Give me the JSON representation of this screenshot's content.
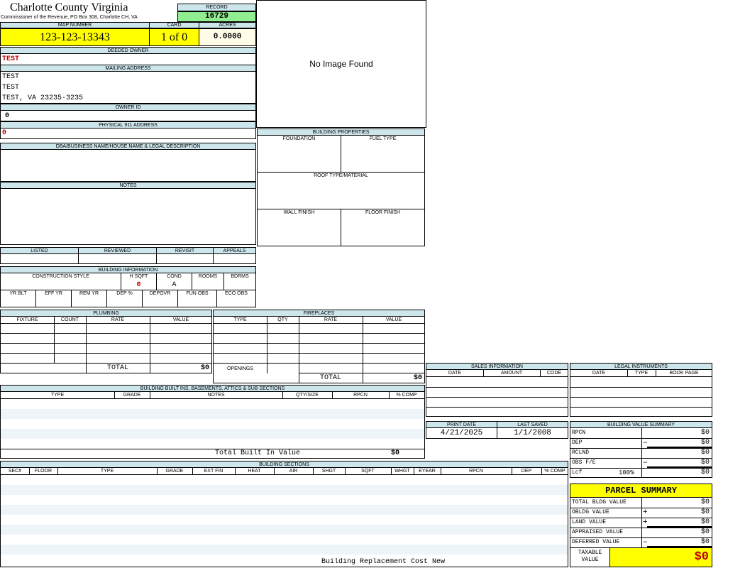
{
  "header": {
    "county": "Charlotte County Virginia",
    "commissioner": "Commissioner of the Revenue, PO Box 308, Charlotte CH, VA",
    "record_label": "RECORD",
    "record_value": "16729"
  },
  "parcel": {
    "map_number_label": "MAP NUMBER",
    "map_number": "123-123-13343",
    "card_label": "CARD",
    "card": "1 of 0",
    "acres_label": "ACRES",
    "acres": "0.0000"
  },
  "owner": {
    "deeded_owner_label": "DEEDED OWNER",
    "deeded_owner": "TEST",
    "mailing_address_label": "MAILING ADDRESS",
    "mailing_lines": [
      "TEST",
      "TEST",
      "TEST, VA 23235-3235"
    ],
    "owner_id_label": "OWNER ID",
    "owner_id": "0",
    "physical_address_label": "PHYSICAL 911 ADDRESS",
    "physical_address": "0"
  },
  "dba_label": "DBA/BUSINESS NAME/HOUSE NAME & LEGAL DESCRIPTION",
  "notes_label": "NOTES",
  "image_placeholder": "No Image Found",
  "building_properties": {
    "title": "BUILDING PROPERTIES",
    "foundation": "FOUNDATION",
    "fuel_type": "FUEL TYPE",
    "roof": "ROOF TYPE/MATERIAL",
    "wall": "WALL FINISH",
    "floor": "FLOOR FINISH"
  },
  "status_headers": [
    "LISTED",
    "REVIEWED",
    "REVISIT",
    "APPEALS"
  ],
  "building_info": {
    "title": "BUILDING INFORMATION",
    "row1": [
      "CONSTRUCTION STYLE",
      "H SQFT",
      "COND",
      "ROOMS",
      "BDRMS"
    ],
    "hsqft": "0",
    "cond": "A",
    "row2": [
      "YR BLT",
      "EFF YR",
      "REM YR",
      "DEP %",
      "DEPOVR",
      "FUN OBS",
      "ECO OBS"
    ]
  },
  "plumbing": {
    "title": "PLUMBING",
    "columns": [
      "FIXTURE",
      "COUNT",
      "RATE",
      "VALUE"
    ],
    "total_label": "TOTAL",
    "total": "$0"
  },
  "fireplaces": {
    "title": "FIREPLACES",
    "columns": [
      "TYPE",
      "QTY",
      "RATE",
      "VALUE"
    ],
    "openings_label": "OPENINGS",
    "total_label": "TOTAL",
    "total": "$0"
  },
  "built_ins": {
    "title": "BUILDING BUILT INS, BASEMENTS, ATTICS & SUB SECTIONS",
    "columns": [
      "TYPE",
      "GRADE",
      "NOTES",
      "QTY/SIZE",
      "RPCN",
      "% COMP"
    ],
    "total_label": "Total Built In Value",
    "total": "$0"
  },
  "sections": {
    "title": "BUILDING SECTIONS",
    "columns": [
      "SEC#",
      "FLOOR",
      "TYPE",
      "GRADE",
      "EXT FIN",
      "HEAT",
      "AIR",
      "SHGT",
      "SQFT",
      "WHGT",
      "EYEAR",
      "RPCN",
      "DEP",
      "% COMP"
    ],
    "footer": "Building Replacement Cost New"
  },
  "sales": {
    "title": "SALES INFORMATION",
    "columns": [
      "DATE",
      "AMOUNT",
      "CODE"
    ]
  },
  "legal": {
    "title": "LEGAL INSTRUMENTS",
    "columns": [
      "DATE",
      "TYPE",
      "BOOK PAGE"
    ]
  },
  "dates": {
    "print_label": "PRINT DATE",
    "print_date": "4/21/2025",
    "saved_label": "LAST SAVED",
    "last_saved": "1/1/2008"
  },
  "value_summary": {
    "title": "BUILDING VALUE SUMMARY",
    "rows": [
      {
        "label": "RPCN",
        "sign": "",
        "value": "$0"
      },
      {
        "label": "DEP",
        "sign": "–",
        "value": "$0"
      },
      {
        "label": "RCLND",
        "sign": "",
        "value": "$0"
      },
      {
        "label": "OBS F/E",
        "sign": "–",
        "value": "$0"
      },
      {
        "label": "Lcf",
        "sign": "",
        "value": "$0",
        "pct": "100%"
      }
    ]
  },
  "parcel_summary": {
    "title": "PARCEL SUMMARY",
    "rows": [
      {
        "label": "TOTAL BLDG VALUE",
        "sign": "",
        "value": "$0"
      },
      {
        "label": "OBLDG VALUE",
        "sign": "+",
        "value": "$0"
      },
      {
        "label": "LAND VALUE",
        "sign": "+",
        "value": "$0"
      },
      {
        "label": "APPRAISED VALUE",
        "sign": "",
        "value": "$0"
      },
      {
        "label": "DEFERRED VALUE",
        "sign": "–",
        "value": "$0"
      }
    ],
    "taxable_label": "TAXABLE VALUE",
    "taxable_value": "$0"
  },
  "colors": {
    "header_bg": "#cde6ec",
    "yellow": "#ffff00",
    "record_green": "#90ee90",
    "acres_bg": "#fffde7",
    "red_text": "#c00000"
  }
}
